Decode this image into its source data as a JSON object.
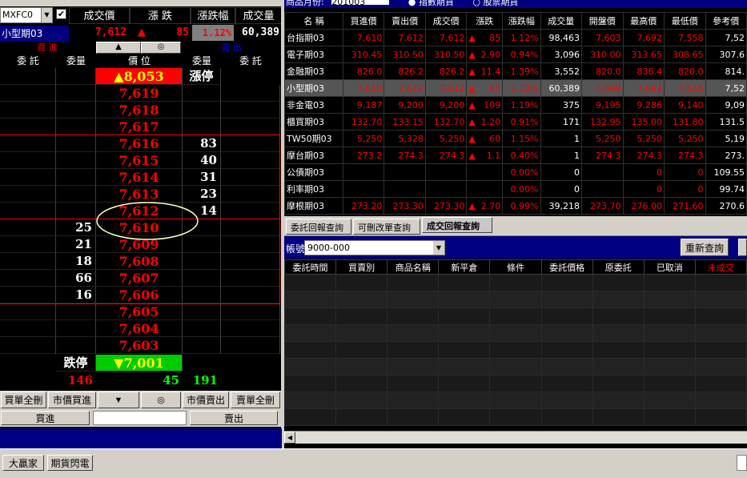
{
  "top": {
    "product_code": "MXFC0",
    "product_name": "小型期03",
    "hdr_trade": "成交價",
    "hdr_chg": "漲 跌",
    "hdr_pct": "漲跌幅",
    "hdr_vol": "成交量",
    "trade": "7,612",
    "chg_arrow": "▲",
    "chg": "85",
    "pct": "1.12%",
    "vol": "60,389",
    "month_label": "商品月份:",
    "month_value": "201003",
    "radio1": "指數期貨",
    "radio2": "股票期貨"
  },
  "ladder": {
    "buy_title": "買 進",
    "sell_title": "賣 出",
    "col_wt": "委  託",
    "col_qty": "委量",
    "col_price": "價  位",
    "up_btn": "▲",
    "mid_btn": "◎",
    "limit_up_price": "▲8,053",
    "limit_up_label": "漲停",
    "limit_down_price": "▼7,001",
    "limit_down_label": "跌停",
    "rows": [
      {
        "price": "7,619",
        "bid": "",
        "ask": ""
      },
      {
        "price": "7,618",
        "bid": "",
        "ask": ""
      },
      {
        "price": "7,617",
        "bid": "",
        "ask": ""
      },
      {
        "price": "7,616",
        "bid": "",
        "ask": "83"
      },
      {
        "price": "7,615",
        "bid": "",
        "ask": "40"
      },
      {
        "price": "7,614",
        "bid": "",
        "ask": "31"
      },
      {
        "price": "7,613",
        "bid": "",
        "ask": "23"
      },
      {
        "price": "7,612",
        "bid": "",
        "ask": "14"
      },
      {
        "price": "7,610",
        "bid": "25",
        "ask": ""
      },
      {
        "price": "7,609",
        "bid": "21",
        "ask": ""
      },
      {
        "price": "7,608",
        "bid": "18",
        "ask": ""
      },
      {
        "price": "7,607",
        "bid": "66",
        "ask": ""
      },
      {
        "price": "7,606",
        "bid": "16",
        "ask": ""
      },
      {
        "price": "7,605",
        "bid": "",
        "ask": ""
      },
      {
        "price": "7,604",
        "bid": "",
        "ask": ""
      },
      {
        "price": "7,603",
        "bid": "",
        "ask": ""
      }
    ],
    "total_bid": "146",
    "total_mid": "45",
    "total_ask": "191"
  },
  "buttons": {
    "buy_all_del": "買單全刪",
    "mkt_buy": "市價買進",
    "down": "▼",
    "center": "◎",
    "mkt_sell": "市價賣出",
    "sell_all_del": "賣單全刪",
    "buy": "買進",
    "sell": "賣出"
  },
  "quotes": {
    "headers": [
      "名 稱",
      "買進價",
      "賣出價",
      "成交價",
      "漲跌",
      "漲跌幅",
      "成交量",
      "開盤價",
      "最高價",
      "最低價",
      "參考價"
    ],
    "rows": [
      {
        "name": "台指期03",
        "bid": "7,610",
        "ask": "7,612",
        "last": "7,612",
        "arrow": "▲",
        "chg": "85",
        "pct": "1.12%",
        "vol": "98,463",
        "open": "7,603",
        "high": "7,692",
        "low": "7,558",
        "ref": "7,52"
      },
      {
        "name": "電子期03",
        "bid": "310.45",
        "ask": "310.50",
        "last": "310.50",
        "arrow": "▲",
        "chg": "2.90",
        "pct": "0.94%",
        "vol": "3,096",
        "open": "310.00",
        "high": "313.65",
        "low": "308.65",
        "ref": "307.6"
      },
      {
        "name": "金融期03",
        "bid": "826.0",
        "ask": "826.2",
        "last": "826.2",
        "arrow": "▲",
        "chg": "11.4",
        "pct": "1.39%",
        "vol": "3,552",
        "open": "820.0",
        "high": "836.4",
        "low": "820.0",
        "ref": "814."
      },
      {
        "name": "小型期03",
        "bid": "7,610",
        "ask": "7,612",
        "last": "7,612",
        "arrow": "▲",
        "chg": "85",
        "pct": "1.12%",
        "vol": "60,389",
        "open": "7,599",
        "high": "7,692",
        "low": "7,558",
        "ref": "7,52"
      },
      {
        "name": "非金電03",
        "bid": "9,187",
        "ask": "9,200",
        "last": "9,200",
        "arrow": "▲",
        "chg": "109",
        "pct": "1.19%",
        "vol": "375",
        "open": "9,195",
        "high": "9,286",
        "low": "9,140",
        "ref": "9,09"
      },
      {
        "name": "櫃買期03",
        "bid": "132.70",
        "ask": "133.15",
        "last": "132.70",
        "arrow": "▲",
        "chg": "1.20",
        "pct": "0.91%",
        "vol": "171",
        "open": "132.95",
        "high": "135.00",
        "low": "131.80",
        "ref": "131.5"
      },
      {
        "name": "TW50期03",
        "bid": "5,250",
        "ask": "5,328",
        "last": "5,250",
        "arrow": "▲",
        "chg": "60",
        "pct": "1.15%",
        "vol": "1",
        "open": "5,250",
        "high": "5,250",
        "low": "5,250",
        "ref": "5,19"
      },
      {
        "name": "摩台期03",
        "bid": "273.2",
        "ask": "274.3",
        "last": "274.3",
        "arrow": "▲",
        "chg": "1.1",
        "pct": "0.40%",
        "vol": "1",
        "open": "274.3",
        "high": "274.3",
        "low": "274.3",
        "ref": "273."
      },
      {
        "name": "公債期03",
        "bid": "",
        "ask": "",
        "last": "",
        "arrow": "",
        "chg": "",
        "pct": "0.00%",
        "vol": "0",
        "open": "",
        "high": "0",
        "low": "0",
        "ref": "109.55"
      },
      {
        "name": "利率期03",
        "bid": "",
        "ask": "",
        "last": "",
        "arrow": "",
        "chg": "",
        "pct": "0.00%",
        "vol": "0",
        "open": "",
        "high": "0",
        "low": "0",
        "ref": "99.74"
      },
      {
        "name": "摩根期03",
        "bid": "273.20",
        "ask": "273.30",
        "last": "273.30",
        "arrow": "▲",
        "chg": "2.70",
        "pct": "0.99%",
        "vol": "39,218",
        "open": "273.70",
        "high": "276.00",
        "low": "271.60",
        "ref": "270.6"
      }
    ]
  },
  "tabs": [
    "委託回報查詢",
    "可刪改單查詢",
    "成交回報查詢"
  ],
  "account": {
    "label": "帳號",
    "value": "9000-000",
    "requery": "重新查詢"
  },
  "orders": {
    "headers": [
      "委託時間",
      "買賣別",
      "商品名稱",
      "新平倉",
      "條件",
      "委託價格",
      "原委託",
      "已取消",
      "未成交"
    ]
  },
  "taskbar": {
    "item1": "大贏家",
    "item2": "期貨閃電"
  }
}
